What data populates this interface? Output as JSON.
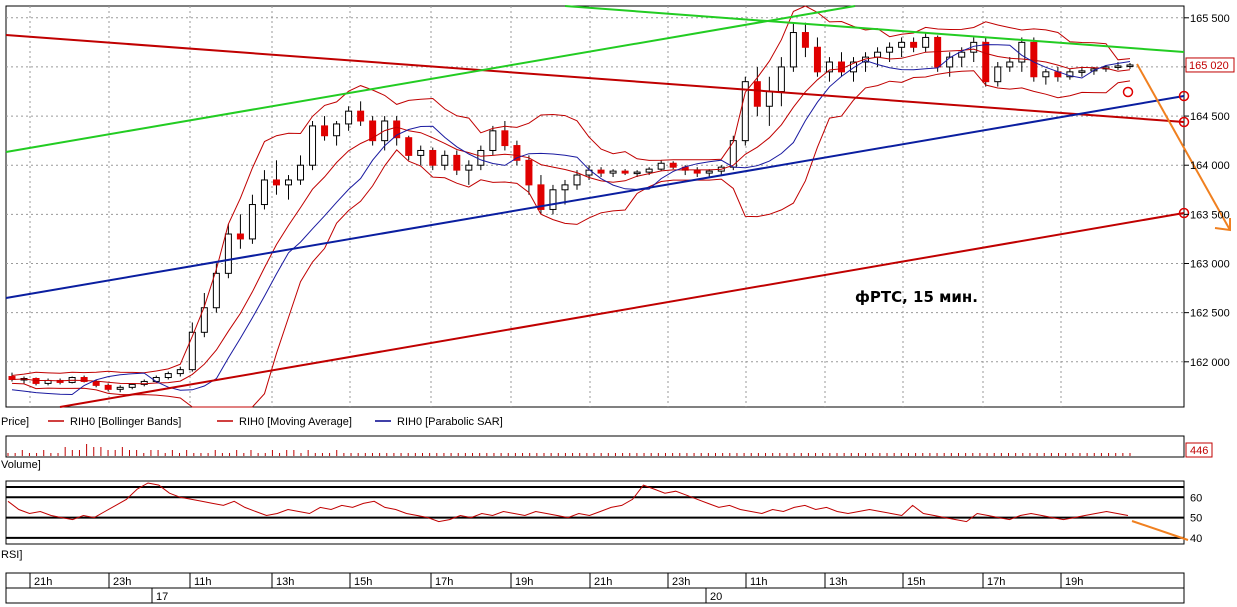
{
  "chart_data": {
    "type": "candlestick",
    "annotation": "фРТС,   15 мин.",
    "price_axis": {
      "ticks": [
        "165 500",
        "165 000",
        "164 500",
        "164 000",
        "163 500",
        "163 000",
        "162 500",
        "162 000"
      ],
      "tick_values": [
        165500,
        165000,
        164500,
        164000,
        163500,
        163000,
        162500,
        162000
      ],
      "last_price_label": "165 020",
      "last_price": 165020,
      "ylim": [
        161540,
        165620
      ]
    },
    "legend": {
      "price": "Price]",
      "items": [
        {
          "name": "RIH0 [Bollinger Bands]",
          "color": "#c00000"
        },
        {
          "name": "RIH0 [Moving Average]",
          "color": "#c00000"
        },
        {
          "name": "RIH0 [Parabolic SAR]",
          "color": "#00008b"
        }
      ]
    },
    "volume": {
      "label": "Volume]",
      "last_value": "446",
      "bars": [
        1,
        1,
        2,
        1,
        1,
        2,
        1,
        1,
        3,
        2,
        2,
        4,
        3,
        3,
        2,
        2,
        3,
        2,
        2,
        1,
        2,
        2,
        1,
        2,
        1,
        2,
        1,
        1,
        1,
        2,
        1,
        1,
        2,
        1,
        2,
        1,
        1,
        2,
        1,
        2,
        2,
        1,
        2,
        1,
        1,
        1,
        2,
        1,
        1,
        1,
        1,
        1,
        1,
        1,
        1,
        1,
        1,
        1,
        1,
        1,
        1,
        1,
        1,
        1,
        1,
        1,
        1,
        1,
        1,
        1,
        1,
        1,
        1,
        1,
        1,
        1,
        1,
        1,
        1,
        1,
        1,
        1,
        1,
        1,
        1,
        1,
        1,
        1,
        1,
        1,
        1,
        1,
        1,
        1,
        1,
        1,
        1,
        1,
        1,
        1,
        1,
        1,
        1,
        1,
        1,
        1,
        1,
        1,
        1,
        1,
        1,
        1,
        1,
        1,
        1,
        1,
        1,
        1,
        1,
        1,
        1,
        1,
        1,
        1,
        1,
        1,
        1,
        1,
        1,
        1,
        1,
        1,
        1,
        1,
        1,
        1,
        1,
        1,
        1,
        1,
        1,
        1,
        1,
        1,
        1,
        1,
        1,
        1,
        1,
        1,
        1,
        1,
        1,
        1,
        1,
        1,
        1,
        1
      ]
    },
    "rsi": {
      "label": "RSI]",
      "ticks": [
        "60",
        "50",
        "40"
      ],
      "tick_values": [
        60,
        50,
        40
      ],
      "ylim": [
        37,
        68
      ],
      "values": [
        58,
        54,
        52,
        53,
        51,
        50,
        49,
        51,
        50,
        53,
        56,
        59,
        64,
        67,
        66,
        62,
        60,
        59,
        58,
        57,
        56,
        58,
        55,
        53,
        51,
        52,
        54,
        53,
        52,
        55,
        54,
        56,
        55,
        57,
        58,
        55,
        54,
        52,
        51,
        50,
        48,
        49,
        51,
        50,
        52,
        51,
        53,
        52,
        51,
        53,
        52,
        51,
        50,
        52,
        51,
        53,
        55,
        56,
        59,
        66,
        64,
        62,
        63,
        61,
        59,
        57,
        55,
        56,
        54,
        53,
        52,
        54,
        53,
        55,
        56,
        54,
        55,
        53,
        52,
        53,
        54,
        53,
        52,
        51,
        56,
        52,
        51,
        50,
        49,
        48,
        52,
        51,
        50,
        49,
        51,
        52,
        51,
        50,
        49,
        50,
        51,
        52,
        53,
        52,
        51
      ]
    },
    "time_axis": {
      "hour_labels": [
        "21h",
        "23h",
        "11h",
        "13h",
        "15h",
        "17h",
        "19h",
        "21h",
        "23h",
        "11h",
        "13h",
        "15h",
        "17h",
        "19h"
      ],
      "day_labels": [
        "17",
        "20"
      ]
    },
    "candles": [
      [
        161850,
        161890,
        161800,
        161820
      ],
      [
        161820,
        161850,
        161780,
        161830
      ],
      [
        161830,
        161840,
        161760,
        161780
      ],
      [
        161780,
        161830,
        161760,
        161810
      ],
      [
        161810,
        161830,
        161770,
        161790
      ],
      [
        161790,
        161850,
        161780,
        161840
      ],
      [
        161840,
        161860,
        161790,
        161800
      ],
      [
        161800,
        161820,
        161740,
        161760
      ],
      [
        161760,
        161780,
        161700,
        161720
      ],
      [
        161720,
        161760,
        161690,
        161740
      ],
      [
        161740,
        161780,
        161720,
        161770
      ],
      [
        161770,
        161820,
        161750,
        161800
      ],
      [
        161800,
        161860,
        161780,
        161840
      ],
      [
        161840,
        161900,
        161820,
        161880
      ],
      [
        161880,
        161950,
        161850,
        161920
      ],
      [
        161920,
        162400,
        161900,
        162300
      ],
      [
        162300,
        162700,
        162250,
        162550
      ],
      [
        162550,
        163000,
        162500,
        162900
      ],
      [
        162900,
        163400,
        162850,
        163300
      ],
      [
        163300,
        163500,
        163150,
        163250
      ],
      [
        163250,
        163700,
        163200,
        163600
      ],
      [
        163600,
        163950,
        163550,
        163850
      ],
      [
        163850,
        164050,
        163700,
        163800
      ],
      [
        163800,
        163900,
        163650,
        163850
      ],
      [
        163850,
        164100,
        163800,
        164000
      ],
      [
        164000,
        164450,
        163950,
        164400
      ],
      [
        164400,
        164500,
        164250,
        164300
      ],
      [
        164300,
        164450,
        164200,
        164420
      ],
      [
        164420,
        164600,
        164350,
        164550
      ],
      [
        164550,
        164650,
        164400,
        164450
      ],
      [
        164450,
        164500,
        164200,
        164250
      ],
      [
        164250,
        164500,
        164150,
        164450
      ],
      [
        164450,
        164500,
        164200,
        164280
      ],
      [
        164280,
        164300,
        164050,
        164100
      ],
      [
        164100,
        164200,
        164000,
        164150
      ],
      [
        164150,
        164180,
        163950,
        164000
      ],
      [
        164000,
        164150,
        163950,
        164100
      ],
      [
        164100,
        164150,
        163900,
        163950
      ],
      [
        163950,
        164050,
        163800,
        164000
      ],
      [
        164000,
        164200,
        163950,
        164150
      ],
      [
        164150,
        164400,
        164100,
        164350
      ],
      [
        164350,
        164450,
        164150,
        164200
      ],
      [
        164200,
        164250,
        164000,
        164050
      ],
      [
        164050,
        164100,
        163700,
        163800
      ],
      [
        163800,
        163900,
        163500,
        163550
      ],
      [
        163550,
        163800,
        163500,
        163750
      ],
      [
        163750,
        163850,
        163600,
        163800
      ],
      [
        163800,
        163950,
        163750,
        163900
      ],
      [
        163900,
        164000,
        163850,
        163950
      ],
      [
        163950,
        163980,
        163880,
        163920
      ],
      [
        163920,
        163960,
        163880,
        163940
      ],
      [
        163940,
        163960,
        163900,
        163920
      ],
      [
        163920,
        163950,
        163880,
        163930
      ],
      [
        163930,
        163980,
        163900,
        163960
      ],
      [
        163960,
        164050,
        163940,
        164020
      ],
      [
        164020,
        164040,
        163960,
        163980
      ],
      [
        163980,
        164000,
        163900,
        163950
      ],
      [
        163950,
        163980,
        163880,
        163920
      ],
      [
        163920,
        163960,
        163880,
        163940
      ],
      [
        163940,
        164000,
        163900,
        163980
      ],
      [
        163980,
        164300,
        163950,
        164250
      ],
      [
        164250,
        164900,
        164200,
        164850
      ],
      [
        164850,
        165000,
        164500,
        164600
      ],
      [
        164600,
        164900,
        164400,
        164750
      ],
      [
        164750,
        165100,
        164600,
        165000
      ],
      [
        165000,
        165450,
        164950,
        165350
      ],
      [
        165350,
        165450,
        165100,
        165200
      ],
      [
        165200,
        165300,
        164900,
        164950
      ],
      [
        164950,
        165100,
        164850,
        165050
      ],
      [
        165050,
        165150,
        164900,
        164950
      ],
      [
        164950,
        165100,
        164850,
        165050
      ],
      [
        165050,
        165150,
        164950,
        165100
      ],
      [
        165100,
        165200,
        165000,
        165150
      ],
      [
        165150,
        165250,
        165050,
        165200
      ],
      [
        165200,
        165300,
        165100,
        165250
      ],
      [
        165250,
        165300,
        165150,
        165200
      ],
      [
        165200,
        165350,
        165150,
        165300
      ],
      [
        165300,
        165320,
        164950,
        165000
      ],
      [
        165000,
        165150,
        164900,
        165100
      ],
      [
        165100,
        165200,
        165000,
        165150
      ],
      [
        165150,
        165300,
        165050,
        165250
      ],
      [
        165250,
        165300,
        164800,
        164850
      ],
      [
        164850,
        165050,
        164800,
        165000
      ],
      [
        165000,
        165100,
        164950,
        165050
      ],
      [
        165050,
        165300,
        164950,
        165250
      ],
      [
        165250,
        165300,
        164850,
        164900
      ],
      [
        164900,
        164980,
        164820,
        164950
      ],
      [
        164950,
        165000,
        164850,
        164900
      ],
      [
        164900,
        164980,
        164870,
        164950
      ],
      [
        164950,
        164990,
        164900,
        164960
      ],
      [
        164960,
        165000,
        164920,
        164980
      ],
      [
        164980,
        165020,
        164950,
        165000
      ],
      [
        165000,
        165050,
        164970,
        165010
      ],
      [
        165010,
        165040,
        164980,
        165020
      ]
    ],
    "indicators_lines": {
      "green_resistance": {
        "color": "#22cc22"
      },
      "blue_support": {
        "color": "#0a1ea0"
      },
      "red_channel_top": {
        "color": "#c00000"
      },
      "red_channel_bottom": {
        "color": "#c00000"
      },
      "forecast": {
        "color": "#f08020"
      }
    }
  }
}
